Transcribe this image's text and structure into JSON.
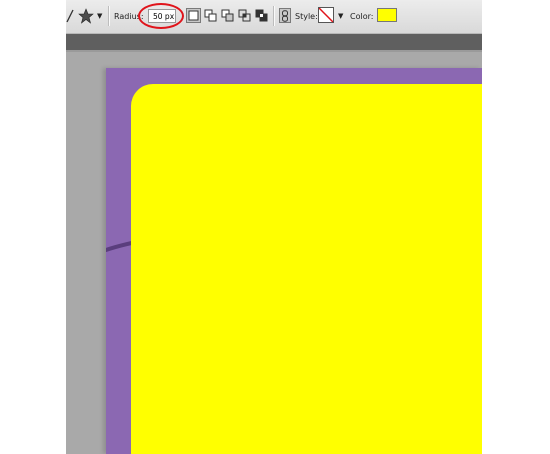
{
  "options_bar": {
    "radius_label": "Radius:",
    "radius_value": "50 px",
    "style_label": "Style:",
    "color_label": "Color:",
    "fill_color": "#ffff00",
    "shape_tool_icon": "custom-shape-icon",
    "mode_icons": [
      "new-layer-mode-icon",
      "add-shape-mode-icon",
      "subtract-shape-mode-icon",
      "intersect-shape-mode-icon",
      "exclude-shape-mode-icon"
    ],
    "link_icon": "link-layer-style-icon",
    "style_icon": "no-style-icon"
  },
  "canvas": {
    "document_color": "#8b68b2",
    "shape_color": "#ffff00",
    "workspace_color": "#a9a9a9",
    "annotation_color": "#e0141b"
  }
}
